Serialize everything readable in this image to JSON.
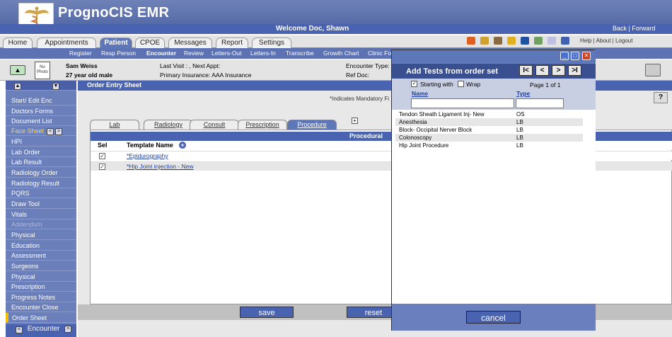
{
  "app": {
    "title": "PrognoCIS EMR",
    "welcome": "Welcome Doc, Shawn",
    "back": "Back | Forward"
  },
  "tabs": [
    "Home",
    "Appointments",
    "Patient",
    "CPOE",
    "Messages",
    "Report",
    "Settings"
  ],
  "top_links": "Help | About | Logout",
  "subnav": [
    "Register",
    "Resp Person",
    "Encounter",
    "Review",
    "Letters-Out",
    "Letters-In",
    "Transcribe",
    "Growth Chart",
    "Clinic Fo"
  ],
  "patient": {
    "name": "Sam Weiss",
    "age": "27 year old male",
    "photo": "No Photo",
    "last_visit": "Last Visit : , Next Appt:",
    "insurance": "Primary Insurance: AAA Insurance",
    "encounter_type": "Encounter Type:",
    "ref_doc": "Ref Doc:"
  },
  "sidebar": [
    "Start/ Edit Enc",
    "Doctors Forms",
    "Document List",
    "Face Sheet",
    "HPI",
    "Lab Order",
    "Lab Result",
    "Radiology Order",
    "Radiology Result",
    "PQRS",
    "Draw Tool",
    "Vitals",
    "Addendum",
    "Physical",
    "Education",
    "Assessment",
    "Surgeons",
    "Physical",
    "Prescription",
    "Progress Notes",
    "Encounter Close",
    "Order Sheet"
  ],
  "sidebar_footer": "Encounter",
  "main": {
    "header": "Order Entry Sheet",
    "mandatory": "*Indicates Mandatory Fi",
    "help": "?",
    "subtabs": [
      "Lab",
      "Radiology",
      "Consult",
      "Prescription",
      "Procedure"
    ],
    "section": "Procedural",
    "col_sel": "Sel",
    "col_template": "Template Name",
    "rows": [
      "*Epidurography",
      "*Hip Joint injection - New"
    ],
    "save": "save",
    "reset": "reset"
  },
  "modal": {
    "title": "Add Tests from order set",
    "starting_with": "Starting with",
    "wrap": "Wrap",
    "page": "Page 1 of 1",
    "col_name": "Name",
    "col_type": "Type",
    "items": [
      {
        "name": "Tendon Sheath Ligament Inj- New",
        "type": "OS"
      },
      {
        "name": "Anesthesia",
        "type": "LB"
      },
      {
        "name": "Block- Occipital Nerver Block",
        "type": "LB"
      },
      {
        "name": "Colonoscopy",
        "type": "LB"
      },
      {
        "name": "Hip Joint Procedure",
        "type": "LB"
      }
    ],
    "cancel": "cancel",
    "first": "I<",
    "prev": "<",
    "next": ">",
    "last": ">I"
  },
  "colors": {
    "nav_blue": "#4a63b0",
    "sidebar_blue": "#6b7fba",
    "selected_accent": "#f0c000"
  }
}
